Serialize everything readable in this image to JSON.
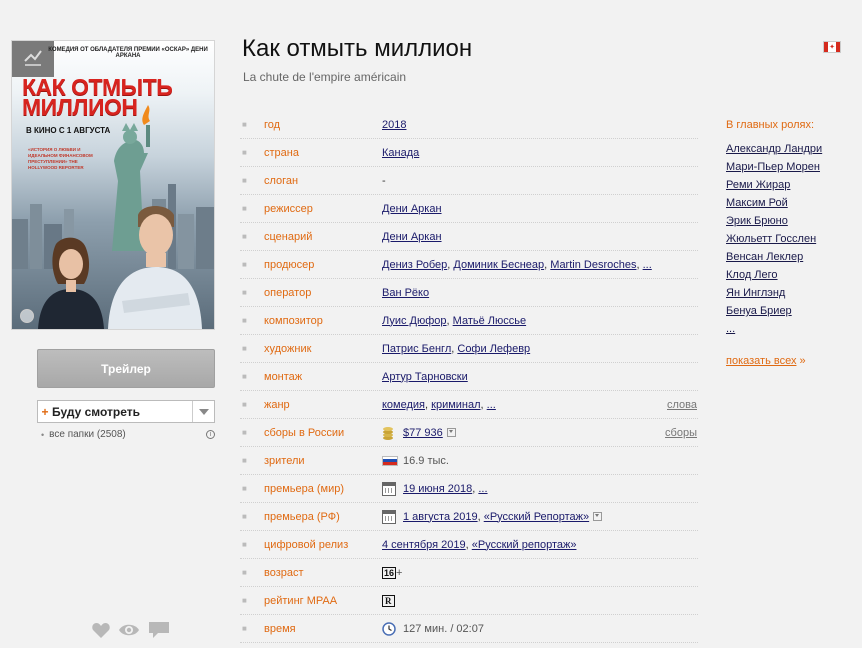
{
  "movie": {
    "title": "Как отмыть миллион",
    "original_title": "La chute de l'empire américain"
  },
  "poster": {
    "tagline": "КОМЕДИЯ ОТ ОБЛАДАТЕЛЯ ПРЕМИИ «ОСКАР» ДЕНИ АРКАНА",
    "title": "КАК ОТМЫТЬ МИЛЛИОН",
    "release": "В КИНО С 1 АВГУСТА",
    "quote": "«ИСТОРИЯ О ЛЮБВИ И ИДЕАЛЬНОМ ФИНАНСОВОМ ПРЕСТУПЛЕНИИ» THE HOLLYWOOD REPORTER"
  },
  "left": {
    "trailer_label": "Трейлер",
    "folder_plus": "+",
    "folder_label": "Буду смотреть",
    "folders_bullet": "•",
    "folders_text": "все папки (2508)",
    "info_glyph": "i"
  },
  "info": {
    "bullet": "■",
    "year": {
      "label": "год",
      "value": "2018"
    },
    "country": {
      "label": "страна",
      "value": "Канада"
    },
    "slogan": {
      "label": "слоган",
      "value": "-"
    },
    "director": {
      "label": "режиссер",
      "value": "Дени Аркан"
    },
    "writer": {
      "label": "сценарий",
      "value": "Дени Аркан"
    },
    "producer": {
      "label": "продюсер",
      "values": [
        "Дениз Робер",
        "Доминик Беснеар",
        "Martin Desroches",
        "..."
      ]
    },
    "operator": {
      "label": "оператор",
      "value": "Ван Рёко"
    },
    "composer": {
      "label": "композитор",
      "values": [
        "Луис Дюфор",
        "Матьё Люссье"
      ]
    },
    "artist": {
      "label": "художник",
      "values": [
        "Патрис Бенгл",
        "Софи Лефевр"
      ]
    },
    "editing": {
      "label": "монтаж",
      "value": "Артур Тарновски"
    },
    "genre": {
      "label": "жанр",
      "values": [
        "комедия",
        "криминал",
        "..."
      ],
      "extra": "слова"
    },
    "boxoffice": {
      "label": "сборы в России",
      "value": "$77 936",
      "extra": "сборы"
    },
    "viewers": {
      "label": "зрители",
      "value": "16.9 тыс."
    },
    "premiere_world": {
      "label": "премьера (мир)",
      "value": "19 июня 2018",
      "more": "..."
    },
    "premiere_rf": {
      "label": "премьера (РФ)",
      "value": "1 августа 2019",
      "distributor": "«Русский Репортаж»"
    },
    "digital": {
      "label": "цифровой релиз",
      "value": "4 сентября 2019",
      "distributor": "«Русский репортаж»"
    },
    "age": {
      "label": "возраст",
      "value": "16",
      "suffix": "+"
    },
    "mpaa": {
      "label": "рейтинг MPAA",
      "value": "R"
    },
    "time": {
      "label": "время",
      "minutes": "127 мин.",
      "duration": "/ 02:07"
    }
  },
  "cast": {
    "title": "В главных ролях:",
    "actors": [
      "Александр Ландри",
      "Мари-Пьер Морен",
      "Реми Жирар",
      "Максим Рой",
      "Эрик Брюно",
      "Жюльетт Госслен",
      "Венсан Леклер",
      "Клод Лего",
      "Ян Инглэнд",
      "Бенуа Бриер",
      "..."
    ],
    "show_all": "показать всех",
    "show_all_arrow": "»"
  },
  "colors": {
    "accent": "#e06a12",
    "link": "#1a1a6a",
    "background": "#f2f2f2"
  }
}
